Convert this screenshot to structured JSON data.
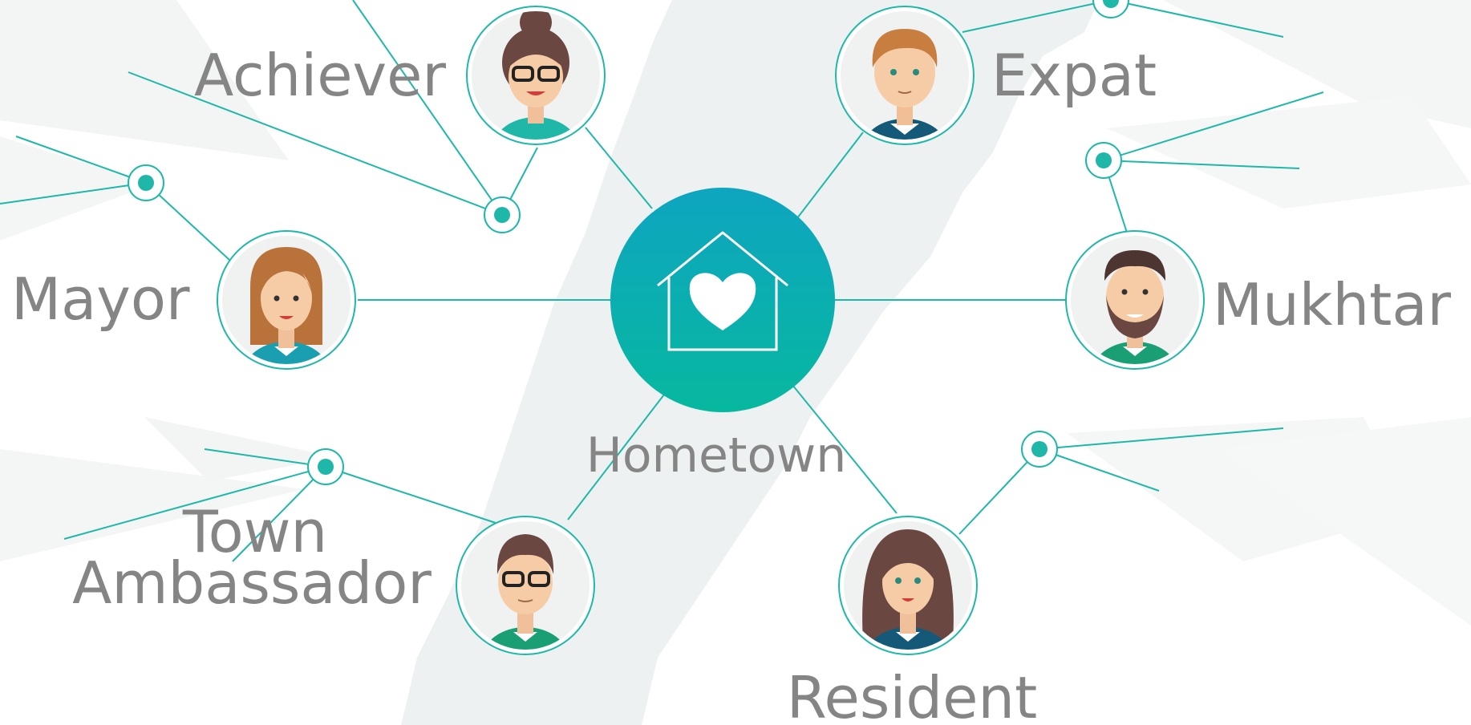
{
  "colors": {
    "teal": "#1fb8a8",
    "teal_dark": "#18a99b",
    "hub_top": "#0ea5c0",
    "hub_bottom": "#07b89f",
    "label": "#858585",
    "map": "#eef1f1",
    "avatar_bg": "#f0f2f2"
  },
  "hub": {
    "label": "Hometown",
    "icon": "house-heart-icon"
  },
  "roles": [
    {
      "id": "achiever",
      "label": "Achiever",
      "avatar": "woman-bun-glasses-avatar"
    },
    {
      "id": "expat",
      "label": "Expat",
      "avatar": "man-short-hair-avatar"
    },
    {
      "id": "mayor",
      "label": "Mayor",
      "avatar": "woman-straight-hair-avatar"
    },
    {
      "id": "mukhtar",
      "label": "Mukhtar",
      "avatar": "man-beard-avatar"
    },
    {
      "id": "town-ambassador",
      "label_line1": "Town",
      "label_line2": "Ambassador",
      "avatar": "man-glasses-avatar"
    },
    {
      "id": "resident",
      "label": "Resident",
      "avatar": "woman-long-hair-avatar"
    }
  ]
}
